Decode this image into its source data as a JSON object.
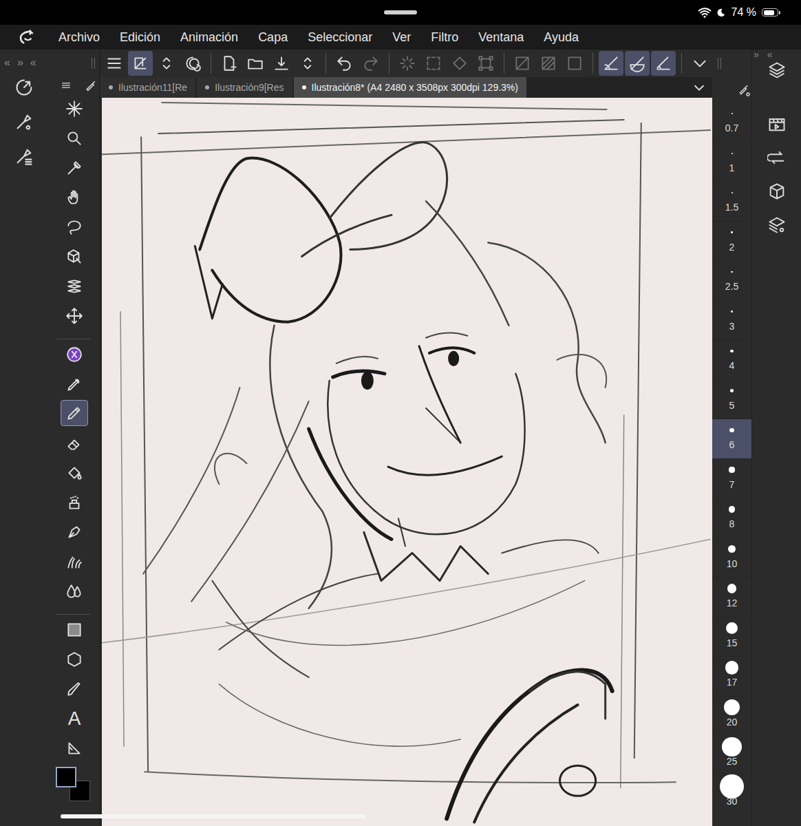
{
  "status_bar": {
    "battery": "74 %",
    "battery_level": 0.74,
    "wifi": true,
    "focus_mode": true
  },
  "menu": [
    "Archivo",
    "Edición",
    "Animación",
    "Capa",
    "Seleccionar",
    "Ver",
    "Filtro",
    "Ventana",
    "Ayuda"
  ],
  "left_toggles": [
    "«",
    "»",
    "«"
  ],
  "right_toggles": [
    "»",
    "«"
  ],
  "command_groups": [
    [
      {
        "selected": false,
        "disabled": false
      },
      {
        "selected": true,
        "disabled": false
      },
      {
        "selected": false,
        "disabled": false
      },
      {
        "selected": false,
        "disabled": false
      }
    ],
    [
      {
        "selected": false,
        "disabled": false
      },
      {
        "selected": false,
        "disabled": false
      },
      {
        "selected": false,
        "disabled": false
      },
      {
        "selected": false,
        "disabled": false
      }
    ],
    [
      {
        "selected": false,
        "disabled": false
      },
      {
        "selected": false,
        "disabled": true
      }
    ],
    [
      {
        "selected": false,
        "disabled": true
      },
      {
        "selected": false,
        "disabled": true
      },
      {
        "selected": false,
        "disabled": true
      },
      {
        "selected": false,
        "disabled": true
      }
    ],
    [
      {
        "selected": false,
        "disabled": true
      },
      {
        "selected": false,
        "disabled": true
      },
      {
        "selected": false,
        "disabled": true
      }
    ],
    [
      {
        "selected": true,
        "disabled": false
      },
      {
        "selected": true,
        "disabled": false
      },
      {
        "selected": true,
        "disabled": false
      }
    ],
    [
      {
        "selected": false,
        "disabled": false
      }
    ]
  ],
  "tabs": [
    {
      "label": "Ilustración11[Re",
      "selected": false,
      "modified": true
    },
    {
      "label": "Ilustración9[Res",
      "selected": false,
      "modified": true
    },
    {
      "label": "Ilustración8* (A4 2480 x 3508px 300dpi 129.3%)",
      "selected": true,
      "modified": true
    }
  ],
  "tool_groups": [
    [
      {
        "selected": false
      },
      {
        "selected": false
      },
      {
        "selected": false
      },
      {
        "selected": false
      },
      {
        "selected": false
      },
      {
        "selected": false
      },
      {
        "selected": false
      },
      {
        "selected": false
      }
    ],
    [
      {
        "selected": false
      },
      {
        "selected": false
      },
      {
        "selected": true
      },
      {
        "selected": false
      },
      {
        "selected": false
      },
      {
        "selected": false
      },
      {
        "selected": false
      },
      {
        "selected": false
      },
      {
        "selected": false
      }
    ],
    [
      {
        "selected": false
      },
      {
        "selected": false
      },
      {
        "selected": false
      },
      {
        "selected": false,
        "glyph": "A"
      },
      {
        "selected": false
      }
    ]
  ],
  "colors": {
    "main": "#000000",
    "sub": "#000000"
  },
  "brush_sizes": [
    {
      "label": "0.7",
      "selected": false
    },
    {
      "label": "1",
      "selected": false
    },
    {
      "label": "1.5",
      "selected": false
    },
    {
      "label": "2",
      "selected": false
    },
    {
      "label": "2.5",
      "selected": false
    },
    {
      "label": "3",
      "selected": false
    },
    {
      "label": "4",
      "selected": false
    },
    {
      "label": "5",
      "selected": false
    },
    {
      "label": "6",
      "selected": true
    },
    {
      "label": "7",
      "selected": false
    },
    {
      "label": "8",
      "selected": false
    },
    {
      "label": "10",
      "selected": false
    },
    {
      "label": "12",
      "selected": false
    },
    {
      "label": "15",
      "selected": false
    },
    {
      "label": "17",
      "selected": false
    },
    {
      "label": "20",
      "selected": false
    },
    {
      "label": "25",
      "selected": false
    },
    {
      "label": "30",
      "selected": false
    }
  ],
  "scrollbar": {
    "level": 0.47
  }
}
